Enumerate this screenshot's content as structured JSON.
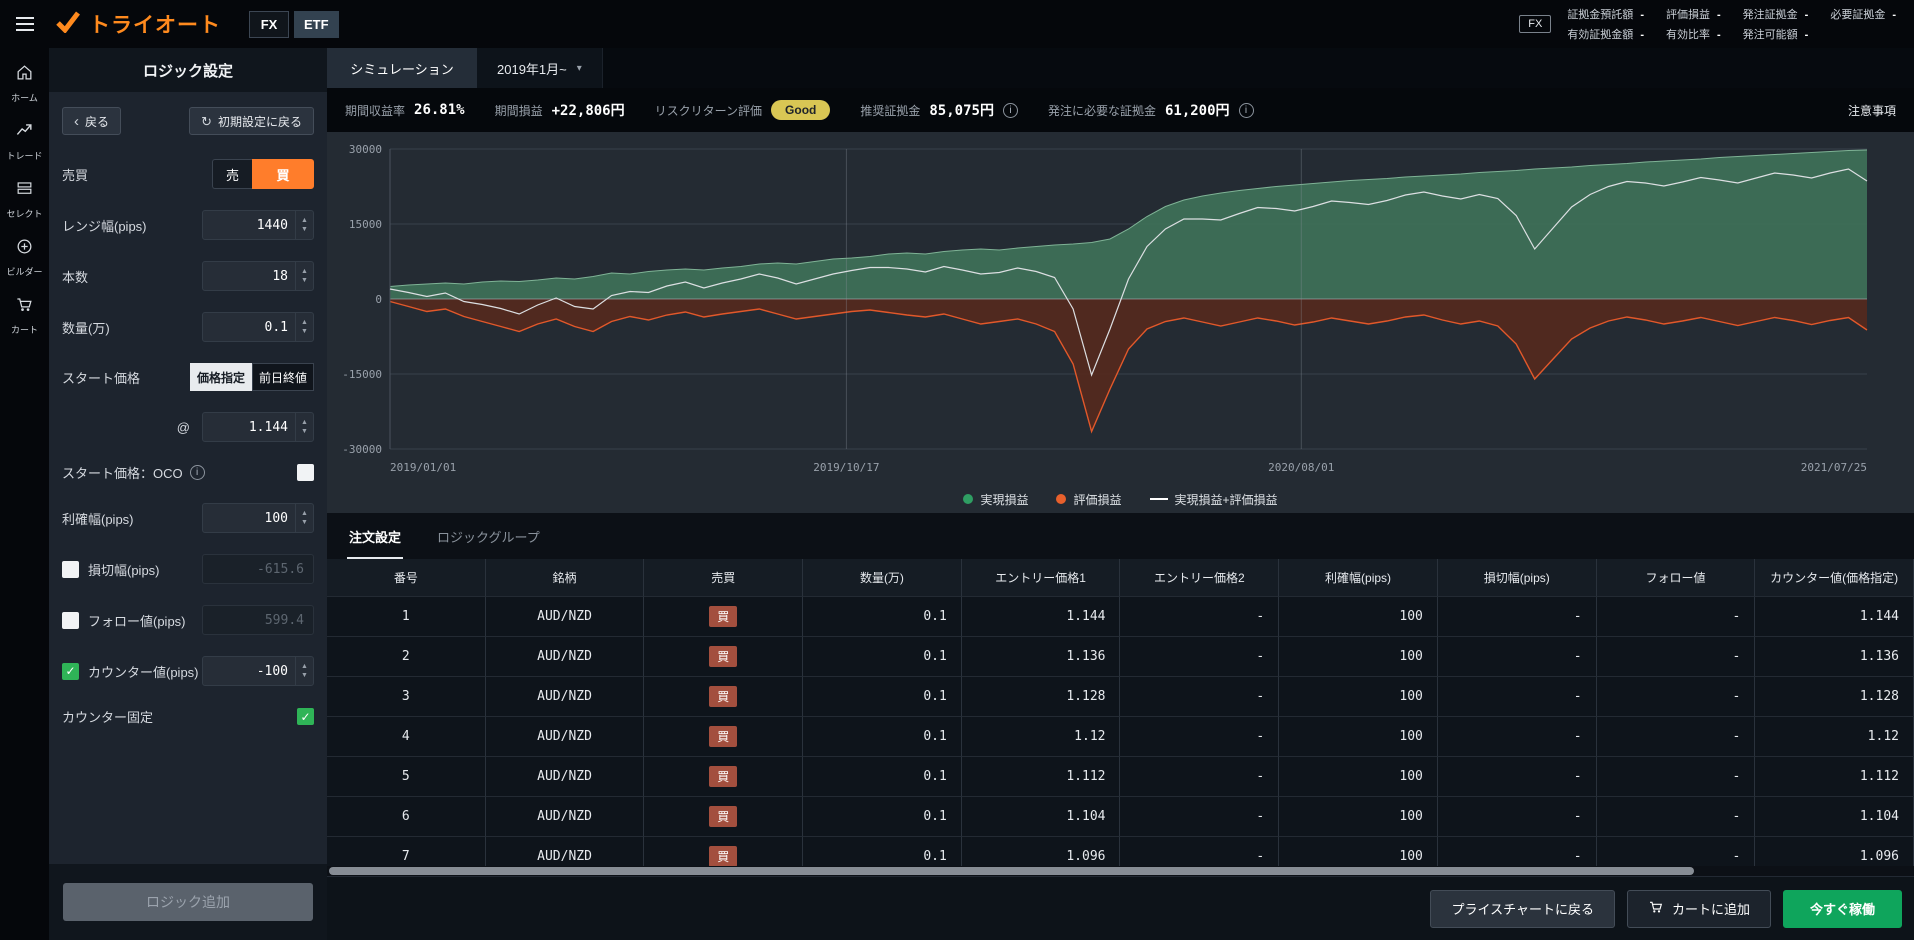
{
  "topbar": {
    "brand": "トライオート",
    "tabs": [
      {
        "label": "FX"
      },
      {
        "label": "ETF"
      }
    ],
    "account_badge": "FX",
    "stats_row1": [
      {
        "label": "証拠金預託額",
        "value": "-"
      },
      {
        "label": "評価損益",
        "value": "-"
      },
      {
        "label": "発注証拠金",
        "value": "-"
      },
      {
        "label": "必要証拠金",
        "value": "-"
      }
    ],
    "stats_row2": [
      {
        "label": "有効証拠金額",
        "value": "-"
      },
      {
        "label": "有効比率",
        "value": "-"
      },
      {
        "label": "発注可能額",
        "value": "-"
      }
    ]
  },
  "nav": {
    "items": [
      {
        "id": "home",
        "label": "ホーム",
        "icon": "home-icon"
      },
      {
        "id": "trade",
        "label": "トレード",
        "icon": "trade-icon"
      },
      {
        "id": "select",
        "label": "セレクト",
        "icon": "select-icon"
      },
      {
        "id": "builder",
        "label": "ビルダー",
        "icon": "builder-icon"
      },
      {
        "id": "cart",
        "label": "カート",
        "icon": "cart-icon"
      }
    ]
  },
  "logic_panel": {
    "title": "ロジック設定",
    "back_button": "戻る",
    "reset_button": "初期設定に戻る",
    "fields": {
      "side_label": "売買",
      "sell": "売",
      "buy": "買",
      "range_label": "レンジ幅(pips)",
      "range_value": "1440",
      "count_label": "本数",
      "count_value": "18",
      "qty_label": "数量(万)",
      "qty_value": "0.1",
      "start_label": "スタート価格",
      "price_specify": "価格指定",
      "prev_close": "前日終値",
      "at_label": "@",
      "at_value": "1.144",
      "oco_label": "スタート価格：OCO",
      "tp_label": "利確幅(pips)",
      "tp_value": "100",
      "sl_label": "損切幅(pips)",
      "sl_value": "-615.6",
      "follow_label": "フォロー値(pips)",
      "follow_value": "599.4",
      "counter_label": "カウンター値(pips)",
      "counter_value": "-100",
      "counter_fix_label": "カウンター固定"
    },
    "add_button": "ロジック追加"
  },
  "simulation": {
    "tab": "シミュレーション",
    "period": "2019年1月~",
    "stats": [
      {
        "label": "期間収益率",
        "value": "26.81%"
      },
      {
        "label": "期間損益",
        "value": "+22,806円"
      },
      {
        "label": "リスクリターン評価",
        "value": "Good",
        "badge": true
      },
      {
        "label": "推奨証拠金",
        "value": "85,075円",
        "info": true
      },
      {
        "label": "発注に必要な証拠金",
        "value": "61,200円",
        "info": true
      }
    ],
    "notice_link": "注意事項"
  },
  "chart_data": {
    "type": "area",
    "title": "シミュレーション損益チャート",
    "unit": "円",
    "ylim": [
      -30000,
      30000
    ],
    "y_ticks": [
      30000,
      15000,
      0,
      -15000,
      -30000
    ],
    "x_ticks": [
      {
        "label": "2019/01/01",
        "pos": 0
      },
      {
        "label": "2019/10/17",
        "pos": 0.309
      },
      {
        "label": "2020/08/01",
        "pos": 0.617
      },
      {
        "label": "2021/07/25",
        "pos": 1
      }
    ],
    "series": [
      {
        "name": "実現損益",
        "type": "area",
        "color": "#3f7158",
        "line_color": "#7fb396",
        "values": [
          2500,
          2800,
          3000,
          3200,
          3000,
          3400,
          3600,
          3500,
          3800,
          4200,
          4000,
          4500,
          5200,
          5000,
          5500,
          5800,
          6000,
          5800,
          6200,
          6500,
          7000,
          7200,
          7000,
          7500,
          8000,
          8200,
          8500,
          9000,
          9200,
          9000,
          9500,
          9800,
          10000,
          9800,
          10200,
          10500,
          10800,
          11000,
          11300,
          12000,
          14000,
          16500,
          18500,
          19800,
          20600,
          21200,
          21700,
          22100,
          22500,
          22800,
          23100,
          23400,
          23700,
          23900,
          24100,
          24400,
          24600,
          24800,
          25000,
          25300,
          25500,
          25700,
          26000,
          26200,
          26400,
          26700,
          26900,
          27100,
          27400,
          27600,
          27800,
          28000,
          28300,
          28500,
          28700,
          28900,
          29100,
          29300,
          29500,
          29700,
          29800
        ]
      },
      {
        "name": "評価損益",
        "type": "area",
        "color": "#53291f",
        "line_color": "#e2582a",
        "values": [
          -500,
          -1500,
          -2500,
          -2000,
          -3500,
          -4500,
          -5500,
          -6500,
          -5000,
          -4000,
          -5500,
          -6500,
          -4500,
          -3500,
          -4200,
          -3200,
          -2600,
          -3600,
          -3000,
          -2500,
          -2000,
          -3000,
          -4000,
          -3500,
          -3000,
          -2500,
          -2200,
          -2700,
          -3200,
          -3600,
          -3000,
          -4000,
          -5000,
          -4500,
          -4000,
          -5000,
          -6500,
          -13000,
          -26500,
          -18000,
          -10000,
          -6000,
          -4500,
          -3800,
          -4600,
          -5400,
          -4600,
          -3800,
          -4400,
          -5200,
          -4600,
          -3800,
          -4400,
          -5000,
          -4400,
          -3600,
          -3200,
          -4200,
          -5000,
          -4400,
          -5400,
          -9000,
          -16000,
          -12000,
          -8000,
          -5800,
          -4400,
          -3600,
          -4200,
          -5000,
          -4400,
          -3700,
          -4500,
          -5300,
          -4500,
          -3700,
          -4300,
          -5100,
          -4300,
          -3700,
          -6200
        ]
      },
      {
        "name": "実現損益+評価損益",
        "type": "line",
        "color": "#dcdfe2",
        "derived": "sum"
      }
    ],
    "legend": [
      {
        "label": "実現損益",
        "swatch": "dot",
        "color": "#2f9e63"
      },
      {
        "label": "評価損益",
        "swatch": "dot",
        "color": "#e8602c"
      },
      {
        "label": "実現損益+評価損益",
        "swatch": "line",
        "color": "#ffffff"
      }
    ]
  },
  "orders": {
    "tabs": [
      "注文設定",
      "ロジックグループ"
    ],
    "columns": [
      "番号",
      "銘柄",
      "売買",
      "数量(万)",
      "エントリー価格1",
      "エントリー価格2",
      "利確幅(pips)",
      "損切幅(pips)",
      "フォロー値",
      "カウンター値(価格指定)"
    ],
    "rows": [
      [
        "1",
        "AUD/NZD",
        "買",
        "0.1",
        "1.144",
        "-",
        "100",
        "-",
        "-",
        "1.144"
      ],
      [
        "2",
        "AUD/NZD",
        "買",
        "0.1",
        "1.136",
        "-",
        "100",
        "-",
        "-",
        "1.136"
      ],
      [
        "3",
        "AUD/NZD",
        "買",
        "0.1",
        "1.128",
        "-",
        "100",
        "-",
        "-",
        "1.128"
      ],
      [
        "4",
        "AUD/NZD",
        "買",
        "0.1",
        "1.12",
        "-",
        "100",
        "-",
        "-",
        "1.12"
      ],
      [
        "5",
        "AUD/NZD",
        "買",
        "0.1",
        "1.112",
        "-",
        "100",
        "-",
        "-",
        "1.112"
      ],
      [
        "6",
        "AUD/NZD",
        "買",
        "0.1",
        "1.104",
        "-",
        "100",
        "-",
        "-",
        "1.104"
      ],
      [
        "7",
        "AUD/NZD",
        "買",
        "0.1",
        "1.096",
        "-",
        "100",
        "-",
        "-",
        "1.096"
      ]
    ]
  },
  "footer": {
    "back_to_chart": "プライスチャートに戻る",
    "add_to_cart": "カートに追加",
    "run_now": "今すぐ稼働"
  },
  "glyphs": {
    "check": "✓",
    "chevron_down": "▾",
    "chevron_left": "‹",
    "reset": "↻",
    "up": "▲",
    "down": "▼",
    "info": "i"
  },
  "colors": {
    "accent_orange": "#ff7d2b",
    "brand_orange": "#ff8a1e",
    "buy_badge": "#a34f3e",
    "run_green": "#0fa55c",
    "check_green": "#2fb457",
    "good_badge": "#d9c654",
    "chart_bg": "#242b33",
    "chart_green": "#3f7158",
    "chart_red": "#53291f",
    "chart_orange": "#e2582a"
  }
}
